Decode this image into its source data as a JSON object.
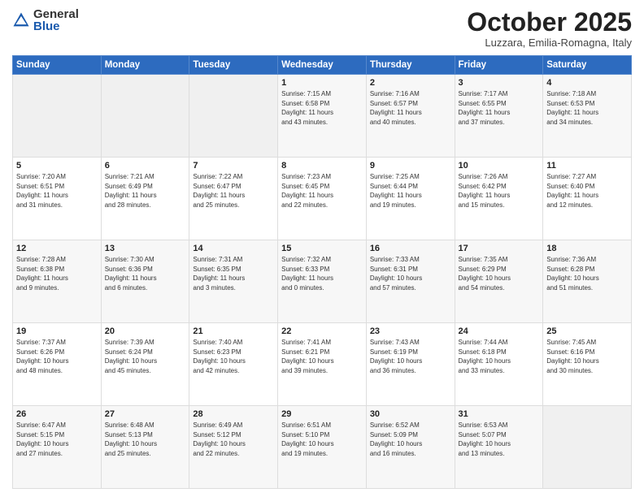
{
  "logo": {
    "general": "General",
    "blue": "Blue"
  },
  "title": "October 2025",
  "subtitle": "Luzzara, Emilia-Romagna, Italy",
  "headers": [
    "Sunday",
    "Monday",
    "Tuesday",
    "Wednesday",
    "Thursday",
    "Friday",
    "Saturday"
  ],
  "weeks": [
    [
      {
        "day": "",
        "info": ""
      },
      {
        "day": "",
        "info": ""
      },
      {
        "day": "",
        "info": ""
      },
      {
        "day": "1",
        "info": "Sunrise: 7:15 AM\nSunset: 6:58 PM\nDaylight: 11 hours\nand 43 minutes."
      },
      {
        "day": "2",
        "info": "Sunrise: 7:16 AM\nSunset: 6:57 PM\nDaylight: 11 hours\nand 40 minutes."
      },
      {
        "day": "3",
        "info": "Sunrise: 7:17 AM\nSunset: 6:55 PM\nDaylight: 11 hours\nand 37 minutes."
      },
      {
        "day": "4",
        "info": "Sunrise: 7:18 AM\nSunset: 6:53 PM\nDaylight: 11 hours\nand 34 minutes."
      }
    ],
    [
      {
        "day": "5",
        "info": "Sunrise: 7:20 AM\nSunset: 6:51 PM\nDaylight: 11 hours\nand 31 minutes."
      },
      {
        "day": "6",
        "info": "Sunrise: 7:21 AM\nSunset: 6:49 PM\nDaylight: 11 hours\nand 28 minutes."
      },
      {
        "day": "7",
        "info": "Sunrise: 7:22 AM\nSunset: 6:47 PM\nDaylight: 11 hours\nand 25 minutes."
      },
      {
        "day": "8",
        "info": "Sunrise: 7:23 AM\nSunset: 6:45 PM\nDaylight: 11 hours\nand 22 minutes."
      },
      {
        "day": "9",
        "info": "Sunrise: 7:25 AM\nSunset: 6:44 PM\nDaylight: 11 hours\nand 19 minutes."
      },
      {
        "day": "10",
        "info": "Sunrise: 7:26 AM\nSunset: 6:42 PM\nDaylight: 11 hours\nand 15 minutes."
      },
      {
        "day": "11",
        "info": "Sunrise: 7:27 AM\nSunset: 6:40 PM\nDaylight: 11 hours\nand 12 minutes."
      }
    ],
    [
      {
        "day": "12",
        "info": "Sunrise: 7:28 AM\nSunset: 6:38 PM\nDaylight: 11 hours\nand 9 minutes."
      },
      {
        "day": "13",
        "info": "Sunrise: 7:30 AM\nSunset: 6:36 PM\nDaylight: 11 hours\nand 6 minutes."
      },
      {
        "day": "14",
        "info": "Sunrise: 7:31 AM\nSunset: 6:35 PM\nDaylight: 11 hours\nand 3 minutes."
      },
      {
        "day": "15",
        "info": "Sunrise: 7:32 AM\nSunset: 6:33 PM\nDaylight: 11 hours\nand 0 minutes."
      },
      {
        "day": "16",
        "info": "Sunrise: 7:33 AM\nSunset: 6:31 PM\nDaylight: 10 hours\nand 57 minutes."
      },
      {
        "day": "17",
        "info": "Sunrise: 7:35 AM\nSunset: 6:29 PM\nDaylight: 10 hours\nand 54 minutes."
      },
      {
        "day": "18",
        "info": "Sunrise: 7:36 AM\nSunset: 6:28 PM\nDaylight: 10 hours\nand 51 minutes."
      }
    ],
    [
      {
        "day": "19",
        "info": "Sunrise: 7:37 AM\nSunset: 6:26 PM\nDaylight: 10 hours\nand 48 minutes."
      },
      {
        "day": "20",
        "info": "Sunrise: 7:39 AM\nSunset: 6:24 PM\nDaylight: 10 hours\nand 45 minutes."
      },
      {
        "day": "21",
        "info": "Sunrise: 7:40 AM\nSunset: 6:23 PM\nDaylight: 10 hours\nand 42 minutes."
      },
      {
        "day": "22",
        "info": "Sunrise: 7:41 AM\nSunset: 6:21 PM\nDaylight: 10 hours\nand 39 minutes."
      },
      {
        "day": "23",
        "info": "Sunrise: 7:43 AM\nSunset: 6:19 PM\nDaylight: 10 hours\nand 36 minutes."
      },
      {
        "day": "24",
        "info": "Sunrise: 7:44 AM\nSunset: 6:18 PM\nDaylight: 10 hours\nand 33 minutes."
      },
      {
        "day": "25",
        "info": "Sunrise: 7:45 AM\nSunset: 6:16 PM\nDaylight: 10 hours\nand 30 minutes."
      }
    ],
    [
      {
        "day": "26",
        "info": "Sunrise: 6:47 AM\nSunset: 5:15 PM\nDaylight: 10 hours\nand 27 minutes."
      },
      {
        "day": "27",
        "info": "Sunrise: 6:48 AM\nSunset: 5:13 PM\nDaylight: 10 hours\nand 25 minutes."
      },
      {
        "day": "28",
        "info": "Sunrise: 6:49 AM\nSunset: 5:12 PM\nDaylight: 10 hours\nand 22 minutes."
      },
      {
        "day": "29",
        "info": "Sunrise: 6:51 AM\nSunset: 5:10 PM\nDaylight: 10 hours\nand 19 minutes."
      },
      {
        "day": "30",
        "info": "Sunrise: 6:52 AM\nSunset: 5:09 PM\nDaylight: 10 hours\nand 16 minutes."
      },
      {
        "day": "31",
        "info": "Sunrise: 6:53 AM\nSunset: 5:07 PM\nDaylight: 10 hours\nand 13 minutes."
      },
      {
        "day": "",
        "info": ""
      }
    ]
  ]
}
